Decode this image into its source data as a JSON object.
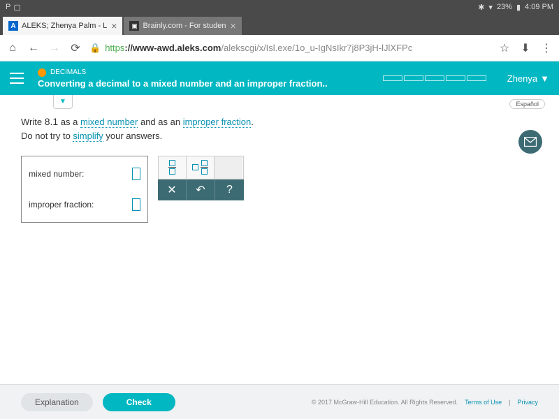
{
  "status_bar": {
    "left_icons": [
      "P",
      "▢"
    ],
    "bluetooth": "✱",
    "wifi": "▾",
    "battery_pct": "23%",
    "battery_icon": "▮",
    "time": "4:09 PM"
  },
  "tabs": [
    {
      "icon": "A",
      "title": "ALEKS; Zhenya Palm - L",
      "active": true
    },
    {
      "icon": "▣",
      "title": "Brainly.com - For studen",
      "active": false
    }
  ],
  "url": {
    "protocol": "https",
    "domain": "://www-awd.aleks.com",
    "path": "/alekscgi/x/Isl.exe/1o_u-IgNsIkr7j8P3jH-lJlXFPc"
  },
  "header": {
    "topic": "DECIMALS",
    "title": "Converting a decimal to a mixed number and an improper fraction..",
    "user": "Zhenya"
  },
  "content": {
    "espanol": "Español",
    "instr_write": "Write ",
    "instr_num": "8.1",
    "instr_as": " as a ",
    "instr_mixed": "mixed number",
    "instr_and": " and as an ",
    "instr_improper": "improper fraction",
    "instr_period": ".",
    "instr_dont": "Do not try to ",
    "instr_simplify": "simplify",
    "instr_answers": " your answers.",
    "label_mixed": "mixed number:",
    "label_improper": "improper fraction:",
    "clear": "✕",
    "undo": "↶",
    "help": "?"
  },
  "footer": {
    "explain": "Explanation",
    "check": "Check",
    "copyright": "© 2017 McGraw-Hill Education. All Rights Reserved.",
    "terms": "Terms of Use",
    "sep": "|",
    "privacy": "Privacy"
  }
}
